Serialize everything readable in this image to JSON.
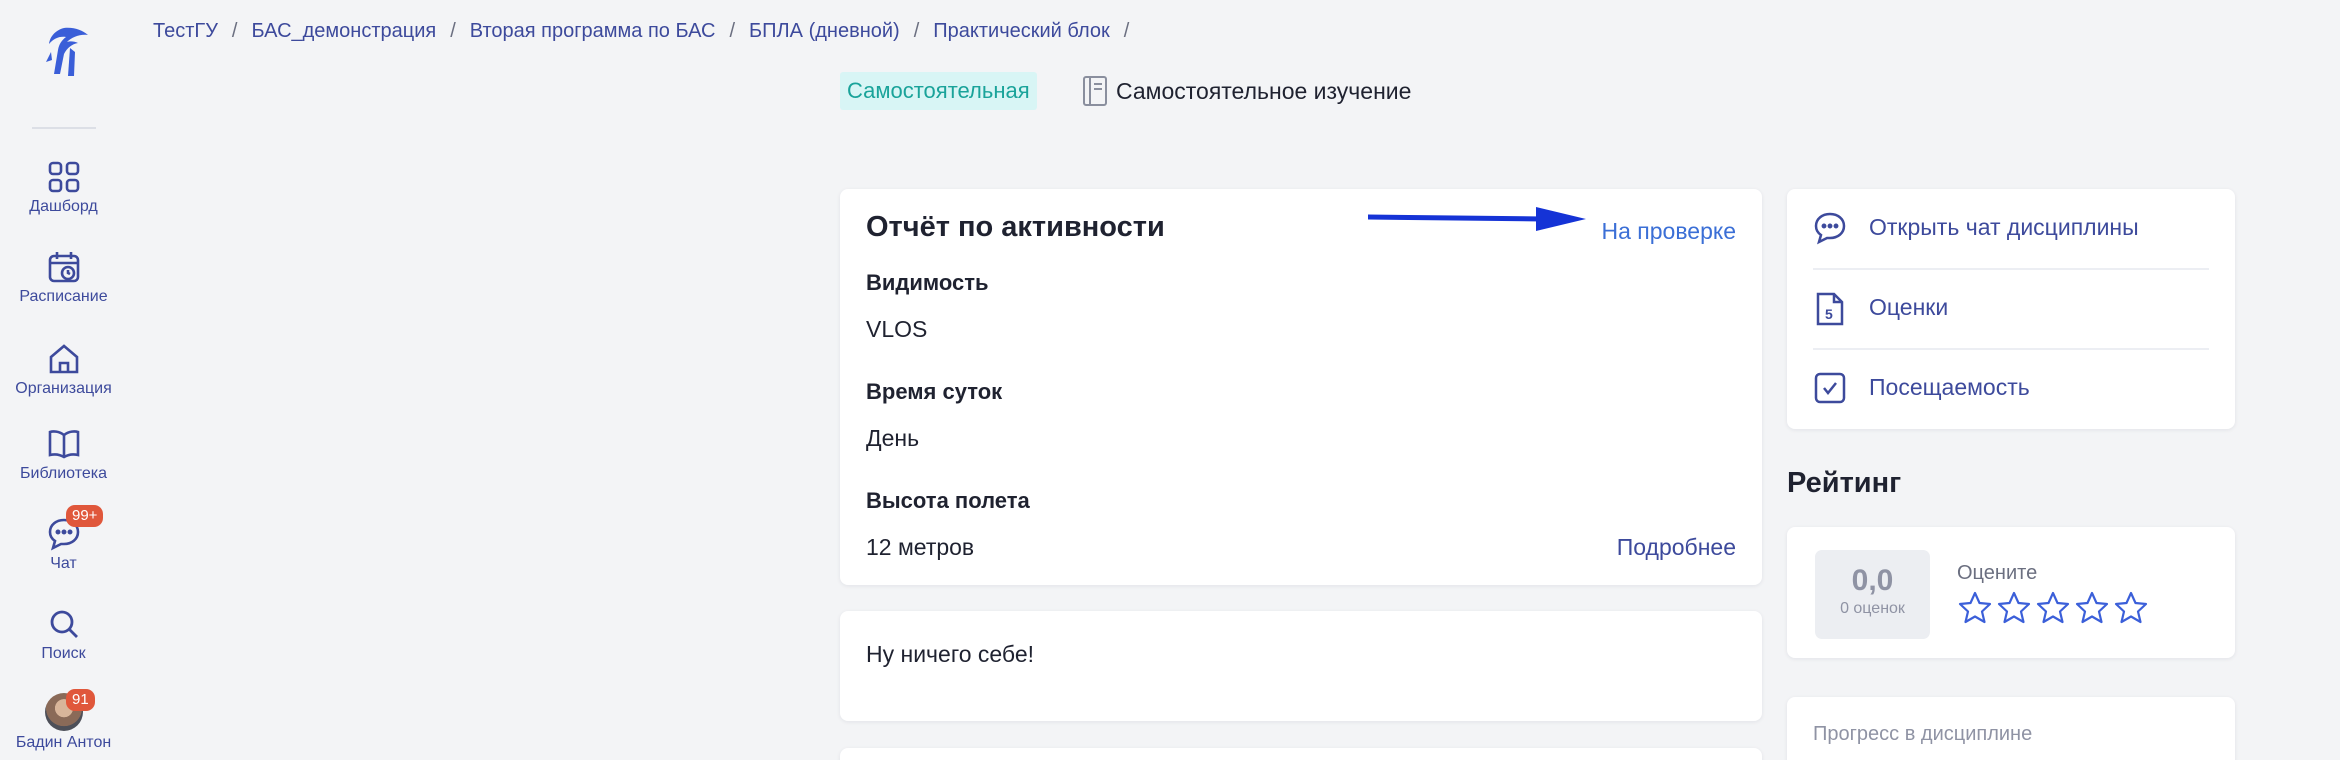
{
  "sidebar": {
    "items": [
      {
        "label": "Дашборд",
        "icon": "dashboard-icon"
      },
      {
        "label": "Расписание",
        "icon": "calendar-icon"
      },
      {
        "label": "Организация",
        "icon": "home-icon"
      },
      {
        "label": "Библиотека",
        "icon": "book-icon"
      },
      {
        "label": "Чат",
        "icon": "chat-icon",
        "badge": "99+"
      },
      {
        "label": "Поиск",
        "icon": "search-icon"
      },
      {
        "label": "Бадин Антон",
        "icon": "avatar",
        "badge": "91"
      }
    ]
  },
  "breadcrumb": [
    "ТестГУ",
    "БАС_демонстрация",
    "Вторая программа по БАС",
    "БПЛА (дневной)",
    "Практический блок"
  ],
  "header": {
    "type_tag": "Самостоятельная",
    "study_label": "Самостоятельное изучение"
  },
  "report": {
    "title": "Отчёт по активности",
    "status": "На проверке",
    "fields": [
      {
        "label": "Видимость",
        "value": "VLOS"
      },
      {
        "label": "Время суток",
        "value": "День"
      },
      {
        "label": "Высота полета",
        "value": "12 метров"
      }
    ],
    "more_link": "Подробнее"
  },
  "comment": {
    "text": "Ну ничего себе!"
  },
  "side_links": [
    {
      "label": "Открыть чат дисциплины",
      "icon": "chat-bubble-icon"
    },
    {
      "label": "Оценки",
      "icon": "grade-file-icon"
    },
    {
      "label": "Посещаемость",
      "icon": "checkbox-icon"
    }
  ],
  "rating": {
    "heading": "Рейтинг",
    "score": "0,0",
    "count": "0 оценок",
    "rate_label": "Оцените",
    "stars_total": 5,
    "stars_filled": 0
  },
  "progress": {
    "label": "Прогресс в дисциплине"
  },
  "colors": {
    "accent": "#3d4a9c",
    "link": "#3b6fd6",
    "tag_bg": "#d8f5f5",
    "tag_text": "#1aa39a",
    "badge": "#e0573b",
    "arrow": "#1533d6"
  }
}
